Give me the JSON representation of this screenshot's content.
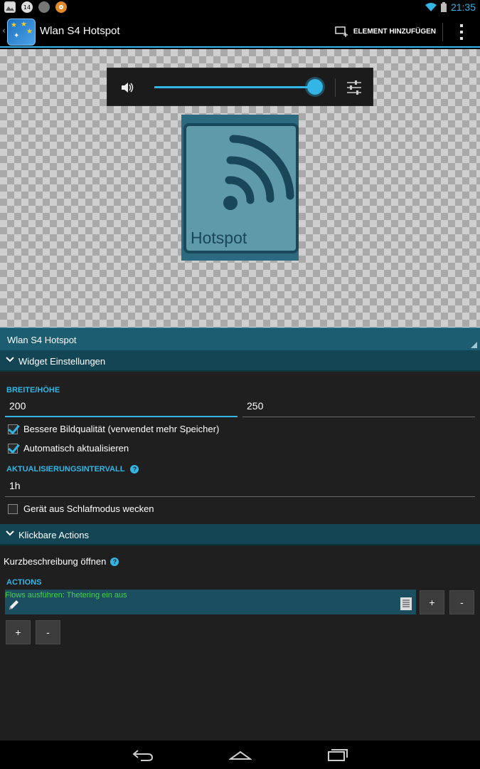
{
  "status": {
    "notif_count": "14",
    "time": "21:35"
  },
  "actionbar": {
    "title": "Wlan S4 Hotspot",
    "add_element_label": "ELEMENT HINZUFÜGEN"
  },
  "preview": {
    "volume_level": 1.0,
    "widget_label": "Hotspot"
  },
  "name_bar": {
    "value": "Wlan S4 Hotspot"
  },
  "widget_settings": {
    "header": "Widget Einstellungen",
    "size_label": "BREITE/HÖHE",
    "width_value": "200",
    "height_value": "250",
    "better_quality_label": "Bessere Bildqualität (verwendet mehr Speicher)",
    "better_quality_checked": true,
    "auto_update_label": "Automatisch aktualisieren",
    "auto_update_checked": true,
    "interval_label": "AKTUALISIERUNGSINTERVALL",
    "interval_value": "1h",
    "wake_label": "Gerät aus Schlafmodus wecken",
    "wake_checked": false
  },
  "clickable_actions": {
    "header": "Klickbare Actions",
    "open_description": "Kurzbeschreibung öffnen",
    "actions_label": "ACTIONS",
    "action_item": "Flows ausführen: Thetering ein aus",
    "plus_label": "+",
    "minus_label": "-"
  },
  "colors": {
    "accent": "#33b5e5",
    "section_header": "#134554",
    "name_bar": "#1c5d72",
    "action_text": "#4bd34b"
  }
}
